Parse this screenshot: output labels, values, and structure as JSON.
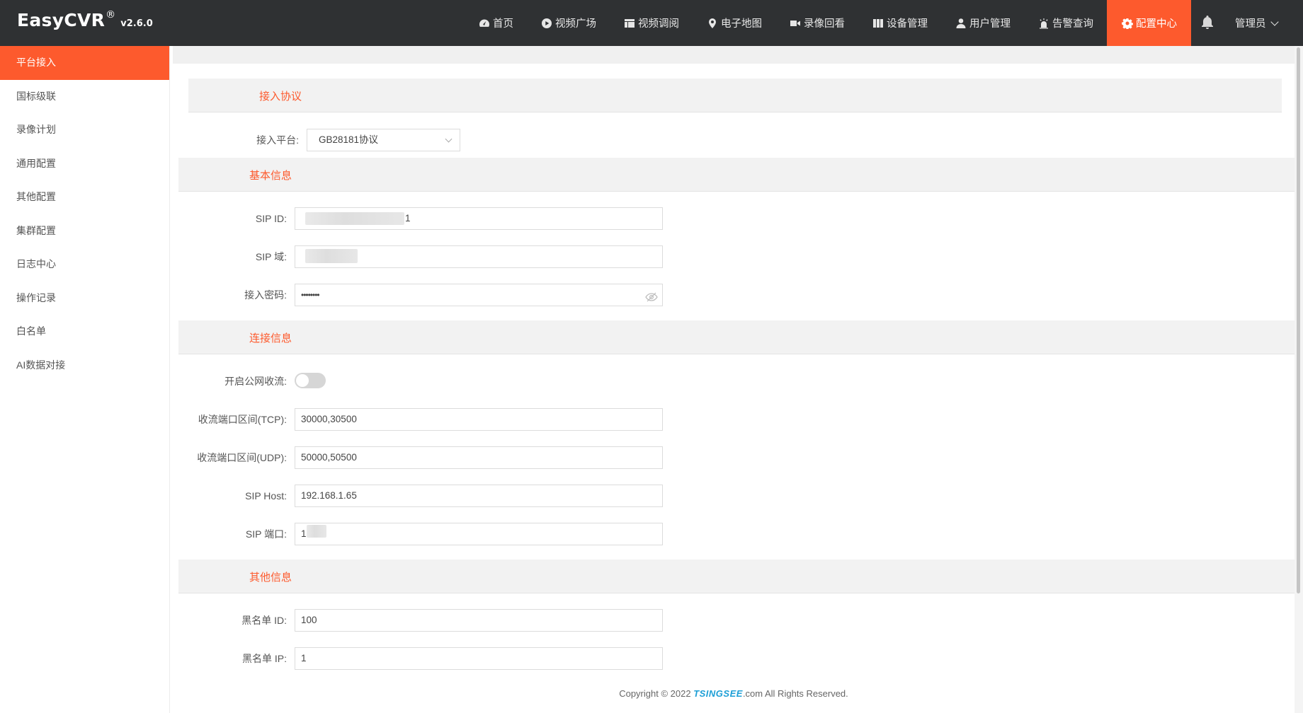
{
  "brand": {
    "name": "EasyCVR",
    "reg": "®",
    "version": "v2.6.0"
  },
  "nav": {
    "items": [
      {
        "label": "首页",
        "icon": "dashboard-icon"
      },
      {
        "label": "视频广场",
        "icon": "play-circle-icon"
      },
      {
        "label": "视频调阅",
        "icon": "layout-icon"
      },
      {
        "label": "电子地图",
        "icon": "map-pin-icon"
      },
      {
        "label": "录像回看",
        "icon": "video-camera-icon"
      },
      {
        "label": "设备管理",
        "icon": "device-icon"
      },
      {
        "label": "用户管理",
        "icon": "user-icon"
      },
      {
        "label": "告警查询",
        "icon": "alarm-icon"
      },
      {
        "label": "配置中心",
        "icon": "gear-icon",
        "active": true
      }
    ],
    "user": "管理员"
  },
  "sidebar": {
    "items": [
      {
        "label": "平台接入",
        "active": true
      },
      {
        "label": "国标级联"
      },
      {
        "label": "录像计划"
      },
      {
        "label": "通用配置"
      },
      {
        "label": "其他配置"
      },
      {
        "label": "集群配置"
      },
      {
        "label": "日志中心"
      },
      {
        "label": "操作记录"
      },
      {
        "label": "白名单"
      },
      {
        "label": "AI数据对接"
      }
    ]
  },
  "sections": {
    "protocol": {
      "title": "接入协议",
      "platform_label": "接入平台:",
      "platform_value": "GB28181协议"
    },
    "basic": {
      "title": "基本信息",
      "sip_id_label": "SIP ID:",
      "sip_id_tail": "1",
      "sip_domain_label": "SIP 域:",
      "password_label": "接入密码:",
      "password_value": "••••••••"
    },
    "connection": {
      "title": "连接信息",
      "public_label": "开启公网收流:",
      "public_enabled": false,
      "tcp_label": "收流端口区间(TCP):",
      "tcp_value": "30000,30500",
      "udp_label": "收流端口区间(UDP):",
      "udp_value": "50000,50500",
      "host_label": "SIP Host:",
      "host_value": "192.168.1.65",
      "port_label": "SIP 端口:",
      "port_prefix": "1"
    },
    "other": {
      "title": "其他信息",
      "blacklist_id_label": "黑名单 ID:",
      "blacklist_id_value": "100",
      "blacklist_ip_label": "黑名单 IP:",
      "blacklist_ip_value": "1"
    }
  },
  "footer": {
    "prefix": "Copyright © 2022 ",
    "logo": "TSINGSEE",
    "suffix": ".com All Rights Reserved."
  },
  "colors": {
    "accent": "#fd5a2d",
    "topbar": "#2f3133"
  }
}
